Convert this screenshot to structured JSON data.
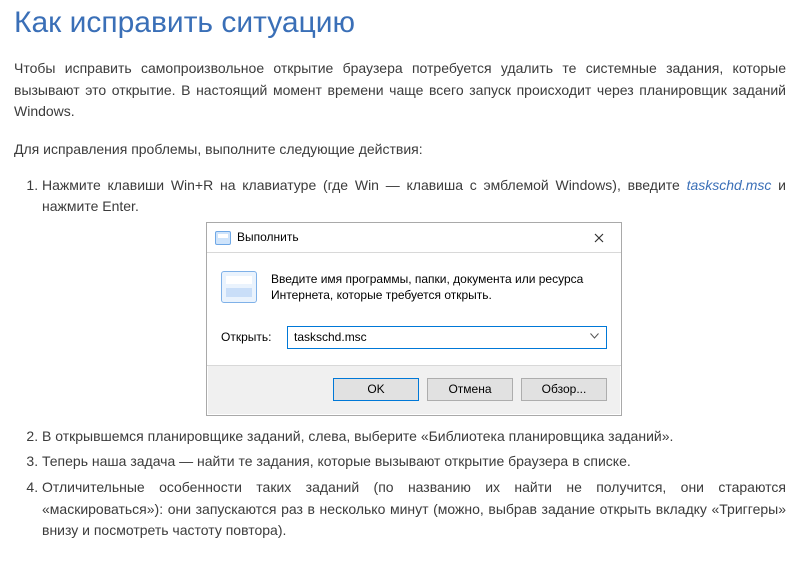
{
  "heading": "Как исправить ситуацию",
  "intro": "Чтобы исправить самопроизвольное открытие браузера потребуется удалить те системные задания, которые вызывают это открытие. В настоящий момент времени чаще всего запуск происходит через планировщик заданий Windows.",
  "lead": "Для исправления проблемы, выполните следующие действия:",
  "steps": {
    "s1_a": "Нажмите клавиши Win+R на клавиатуре (где Win — клавиша с эмблемой Windows), введите ",
    "s1_cmd": "taskschd.msc",
    "s1_b": " и нажмите Enter.",
    "s2": "В открывшемся планировщике заданий, слева, выберите «Библиотека планировщика заданий».",
    "s3": "Теперь наша задача — найти те задания, которые вызывают открытие браузера в списке.",
    "s4": "Отличительные особенности таких заданий (по названию их найти не получится, они стараются «маскироваться»): они запускаются раз в несколько минут (можно, выбрав задание открыть вкладку «Триггеры» внизу и посмотреть частоту повтора)."
  },
  "dialog": {
    "title": "Выполнить",
    "hint": "Введите имя программы, папки, документа или ресурса Интернета, которые требуется открыть.",
    "open_label": "Открыть:",
    "value": "taskschd.msc",
    "ok": "OK",
    "cancel": "Отмена",
    "browse": "Обзор..."
  }
}
